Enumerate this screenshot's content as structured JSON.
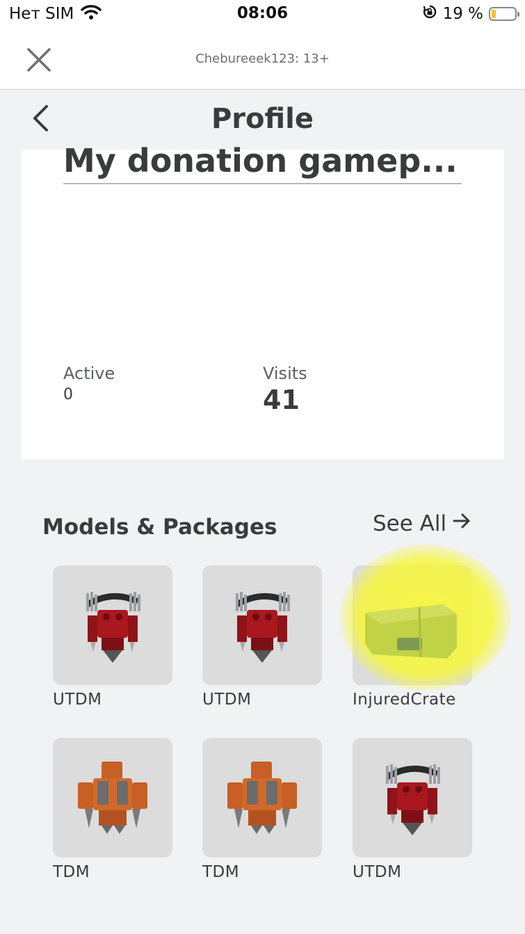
{
  "status_bar": {
    "carrier": "Нет SIM",
    "time": "08:06",
    "battery_text": "19 %",
    "battery_level": 0.19,
    "icons": [
      "wifi-icon",
      "rotation-lock-icon",
      "battery-icon"
    ]
  },
  "topbar": {
    "account_label": "Chebureeek123: 13+",
    "icons": [
      "close-icon"
    ]
  },
  "page": {
    "title": "Profile"
  },
  "game_card": {
    "title": "My donation gamep...",
    "active_label": "Active",
    "active_value": "0",
    "visits_label": "Visits",
    "visits_value": "41"
  },
  "models_section": {
    "title": "Models & Packages",
    "see_all_label": "See All",
    "items": [
      {
        "label": "UTDM",
        "thumbnail": "red-robot-avatar"
      },
      {
        "label": "UTDM",
        "thumbnail": "red-robot-avatar"
      },
      {
        "label": "InjuredCrate",
        "thumbnail": "green-crate",
        "highlighted": true
      },
      {
        "label": "TDM",
        "thumbnail": "orange-robot-avatar"
      },
      {
        "label": "TDM",
        "thumbnail": "orange-robot-avatar"
      },
      {
        "label": "UTDM",
        "thumbnail": "red-robot-avatar"
      }
    ]
  },
  "colors": {
    "background": "#f1f2f4",
    "card": "#ffffff",
    "text": "#393b3d",
    "highlight": "#f6f63c",
    "battery": "#f3c623"
  }
}
